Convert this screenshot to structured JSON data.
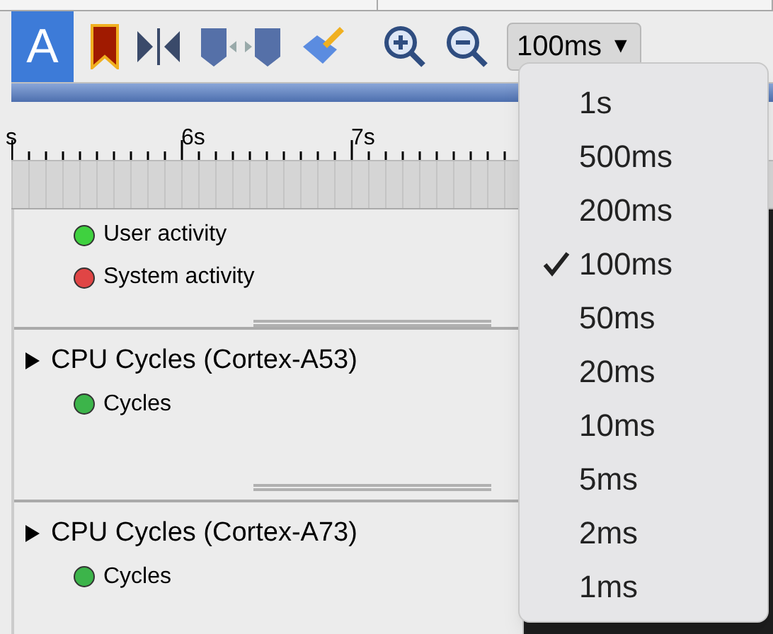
{
  "toolbar": {
    "annotate_label": "A",
    "zoom_value": "100ms",
    "zoom_caret": "▼"
  },
  "ruler": {
    "labels": [
      "s",
      "6s",
      "7s"
    ]
  },
  "legend": [
    {
      "label": "User activity",
      "color": "#3fd13f"
    },
    {
      "label": "System activity",
      "color": "#e04545"
    }
  ],
  "sections": [
    {
      "title": "CPU Cycles (Cortex-A53)",
      "expanded": false,
      "series": [
        {
          "label": "Cycles",
          "color": "#3cb44a"
        }
      ]
    },
    {
      "title": "CPU Cycles (Cortex-A73)",
      "expanded": false,
      "series": [
        {
          "label": "Cycles",
          "color": "#3cb44a"
        }
      ]
    }
  ],
  "zoom_menu": [
    {
      "label": "1s",
      "selected": false
    },
    {
      "label": "500ms",
      "selected": false
    },
    {
      "label": "200ms",
      "selected": false
    },
    {
      "label": "100ms",
      "selected": true
    },
    {
      "label": "50ms",
      "selected": false
    },
    {
      "label": "20ms",
      "selected": false
    },
    {
      "label": "10ms",
      "selected": false
    },
    {
      "label": "5ms",
      "selected": false
    },
    {
      "label": "2ms",
      "selected": false
    },
    {
      "label": "1ms",
      "selected": false
    }
  ]
}
